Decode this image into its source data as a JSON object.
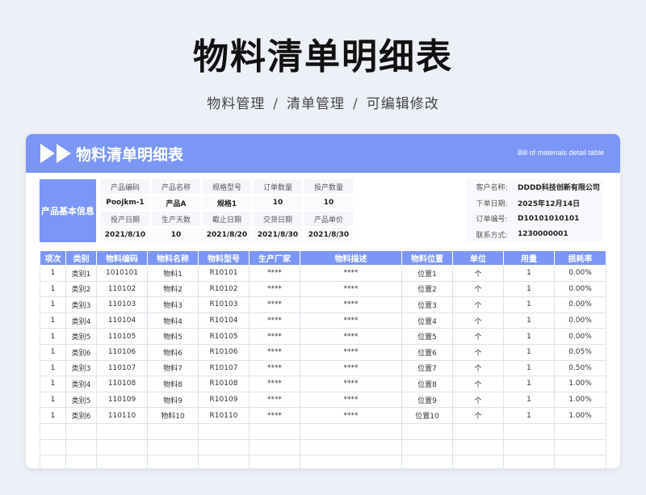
{
  "page": {
    "title": "物料清单明细表",
    "breadcrumb": [
      "物料管理",
      "清单管理",
      "可编辑修改"
    ],
    "separator": "/"
  },
  "card": {
    "title": "物料清单明细表",
    "subtitle": "Bill of materials detail table",
    "accent_color": "#7b96f5"
  },
  "product_info": {
    "section_label": "产品基本信息",
    "labels_row1": [
      "产品编码",
      "产品名称",
      "规格型号",
      "订单数量",
      "投产数量"
    ],
    "values_row1": [
      "Poojkm-1",
      "产品A",
      "规格1",
      "10",
      "10"
    ],
    "labels_row2": [
      "投产日期",
      "生产天数",
      "截止日期",
      "交货日期",
      "产品单价"
    ],
    "values_row2": [
      "2021/8/10",
      "10",
      "2021/8/20",
      "2021/8/30",
      "2021/8/30"
    ]
  },
  "customer": [
    {
      "label": "客户名称:",
      "value": "DDDD科技创新有限公司"
    },
    {
      "label": "下单日期:",
      "value": "2025年12月14日"
    },
    {
      "label": "订单编号:",
      "value": "D10101010101"
    },
    {
      "label": "联系方式:",
      "value": "1230000001"
    }
  ],
  "table": {
    "headers": [
      "项次",
      "类别",
      "物料编码",
      "物料名称",
      "物料型号",
      "生产厂家",
      "物料描述",
      "物料位置",
      "单位",
      "用量",
      "损耗率"
    ],
    "rows": [
      [
        "1",
        "类别1",
        "1010101",
        "物料1",
        "R10101",
        "****",
        "****",
        "位置1",
        "个",
        "1",
        "0.00%"
      ],
      [
        "1",
        "类别2",
        "110102",
        "物料2",
        "R10102",
        "****",
        "****",
        "位置2",
        "个",
        "1",
        "0.00%"
      ],
      [
        "1",
        "类别3",
        "110103",
        "物料3",
        "R10103",
        "****",
        "****",
        "位置3",
        "个",
        "1",
        "0.00%"
      ],
      [
        "1",
        "类别4",
        "110104",
        "物料4",
        "R10104",
        "****",
        "****",
        "位置4",
        "个",
        "1",
        "0.00%"
      ],
      [
        "1",
        "类别5",
        "110105",
        "物料5",
        "R10105",
        "****",
        "****",
        "位置5",
        "个",
        "1",
        "0.00%"
      ],
      [
        "1",
        "类别6",
        "110106",
        "物料6",
        "R10106",
        "****",
        "****",
        "位置6",
        "个",
        "1",
        "0.05%"
      ],
      [
        "1",
        "类别3",
        "110107",
        "物料7",
        "R10107",
        "****",
        "****",
        "位置7",
        "个",
        "1",
        "0.50%"
      ],
      [
        "1",
        "类别4",
        "110108",
        "物料8",
        "R10108",
        "****",
        "****",
        "位置8",
        "个",
        "1",
        "1.00%"
      ],
      [
        "1",
        "类别5",
        "110109",
        "物料9",
        "R10109",
        "****",
        "****",
        "位置9",
        "个",
        "1",
        "1.00%"
      ],
      [
        "1",
        "类别6",
        "110110",
        "物料10",
        "R10110",
        "****",
        "****",
        "位置10",
        "个",
        "1",
        "1.00%"
      ]
    ],
    "empty_rows": 3
  }
}
